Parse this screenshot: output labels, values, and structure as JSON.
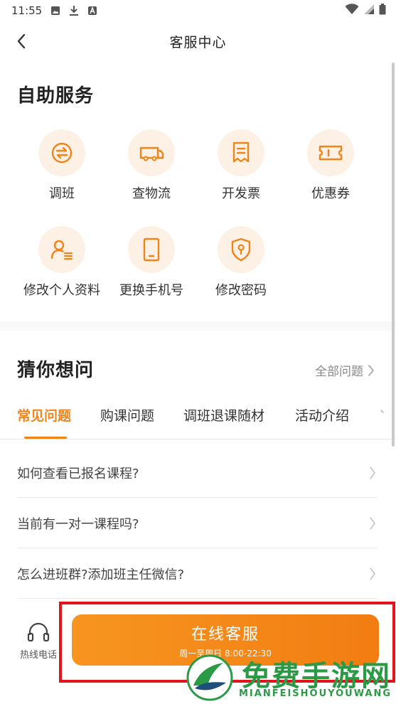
{
  "status_bar": {
    "time": "11:55"
  },
  "nav": {
    "title": "客服中心"
  },
  "self_service": {
    "title": "自助服务",
    "items": [
      {
        "label": "调班",
        "icon": "swap-icon"
      },
      {
        "label": "查物流",
        "icon": "truck-icon"
      },
      {
        "label": "开发票",
        "icon": "receipt-icon"
      },
      {
        "label": "优惠券",
        "icon": "ticket-icon"
      },
      {
        "label": "修改个人资料",
        "icon": "user-edit-icon"
      },
      {
        "label": "更换手机号",
        "icon": "phone-icon"
      },
      {
        "label": "修改密码",
        "icon": "shield-key-icon"
      }
    ]
  },
  "faq": {
    "title": "猜你想问",
    "all_link": "全部问题",
    "tabs": [
      "常见问题",
      "购课问题",
      "调班退课随材",
      "活动介绍"
    ],
    "active_tab": "常见问题",
    "questions": [
      "如何查看已报名课程?",
      "当前有一对一课程吗?",
      "怎么进班群?添加班主任微信?"
    ]
  },
  "bottom": {
    "hotline_label": "热线电话",
    "online_cs_label": "在线客服",
    "online_cs_hours": "周一至周日 8:00-22:30"
  },
  "watermark": {
    "title": "免费手游网",
    "subtitle": "MIANFEISHOUYOUWANG"
  },
  "colors": {
    "accent": "#f08418",
    "icon_bg": "#fdf1e6",
    "highlight": "#e0141a",
    "watermark_green": "#2a9a44"
  }
}
